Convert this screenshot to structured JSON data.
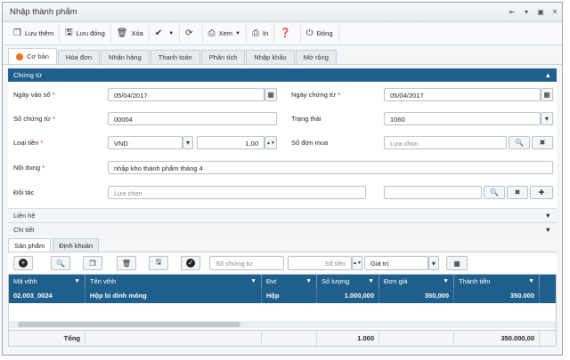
{
  "window": {
    "title": "Nhập thành phẩm",
    "controls": [
      "⇤",
      "▾",
      "▣",
      "✕"
    ]
  },
  "toolbar": {
    "save_new": "Lưu thêm",
    "save_close": "Lưu đóng",
    "delete": "Xóa",
    "view": "Xem",
    "print": "In",
    "close": "Đóng"
  },
  "tabs": [
    "Cơ bản",
    "Hóa đơn",
    "Nhận hàng",
    "Thanh toán",
    "Phân tích",
    "Nhập khẩu",
    "Mở rộng"
  ],
  "section": {
    "title": "Chứng từ"
  },
  "form": {
    "entry_date_label": "Ngày vào sổ",
    "entry_date": "05/04/2017",
    "doc_date_label": "Ngày chứng từ",
    "doc_date": "05/04/2017",
    "doc_no_label": "Số chứng từ",
    "doc_no": "00004",
    "status_label": "Trạng thái",
    "status": "1060",
    "currency_label": "Loại tiền",
    "currency": "VND",
    "rate": "1,00",
    "po_label": "Số đơn mua",
    "po_placeholder": "Lựa chọn",
    "content_label": "Nội dung",
    "content": "nhập kho thành phẩm tháng 4",
    "partner_label": "Đối tác",
    "partner_placeholder": "Lựa chọn"
  },
  "collapsibles": [
    "Liên hệ",
    "Chi tiết"
  ],
  "subtabs": [
    "Sản phẩm",
    "Định khoản"
  ],
  "grid_tools": {
    "doc_no_placeholder": "Số chứng từ",
    "amount_placeholder": "Số tiền",
    "value_label": "Giá trị"
  },
  "grid": {
    "columns": [
      "Mã vthh",
      "Tên vthh",
      "Đvt",
      "Số lượng",
      "Đơn giá",
      "Thành tiền"
    ],
    "rows": [
      [
        "02.003_0024",
        "Hộp bi dính móng",
        "Hộp",
        "1.000,000",
        "350,000",
        "350.000"
      ]
    ],
    "footer": {
      "label": "Tổng",
      "qty": "1.000",
      "total": "350.000,00"
    }
  }
}
